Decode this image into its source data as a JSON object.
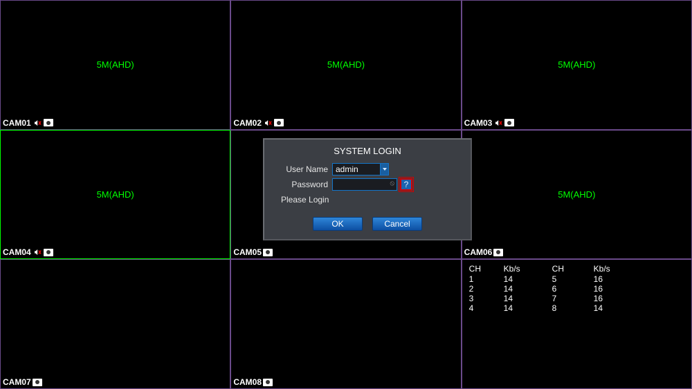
{
  "grid": {
    "cells": [
      {
        "label": "5M(AHD)",
        "cam": "CAM01",
        "speaker": true,
        "selected": false,
        "stats": null
      },
      {
        "label": "5M(AHD)",
        "cam": "CAM02",
        "speaker": true,
        "selected": false,
        "stats": null
      },
      {
        "label": "5M(AHD)",
        "cam": "CAM03",
        "speaker": true,
        "selected": false,
        "stats": null
      },
      {
        "label": "5M(AHD)",
        "cam": "CAM04",
        "speaker": true,
        "selected": true,
        "stats": null
      },
      {
        "label": "",
        "cam": "CAM05",
        "speaker": false,
        "selected": false,
        "stats": null
      },
      {
        "label": "5M(AHD)",
        "cam": "CAM06",
        "speaker": false,
        "selected": false,
        "stats": null
      },
      {
        "label": "",
        "cam": "CAM07",
        "speaker": false,
        "selected": false,
        "stats": null
      },
      {
        "label": "",
        "cam": "CAM08",
        "speaker": false,
        "selected": false,
        "stats": null
      },
      {
        "label": "",
        "cam": "",
        "speaker": false,
        "selected": false,
        "stats": {
          "headers": [
            "CH",
            "Kb/s",
            "CH",
            "Kb/s"
          ],
          "rows": [
            [
              "1",
              "14",
              "5",
              "16"
            ],
            [
              "2",
              "14",
              "6",
              "16"
            ],
            [
              "3",
              "14",
              "7",
              "16"
            ],
            [
              "4",
              "14",
              "8",
              "14"
            ]
          ]
        }
      }
    ]
  },
  "dialog": {
    "title": "SYSTEM LOGIN",
    "username_label": "User Name",
    "username_value": "admin",
    "password_label": "Password",
    "password_value": "",
    "help_label": "?",
    "status_text": "Please Login",
    "ok_label": "OK",
    "cancel_label": "Cancel"
  }
}
